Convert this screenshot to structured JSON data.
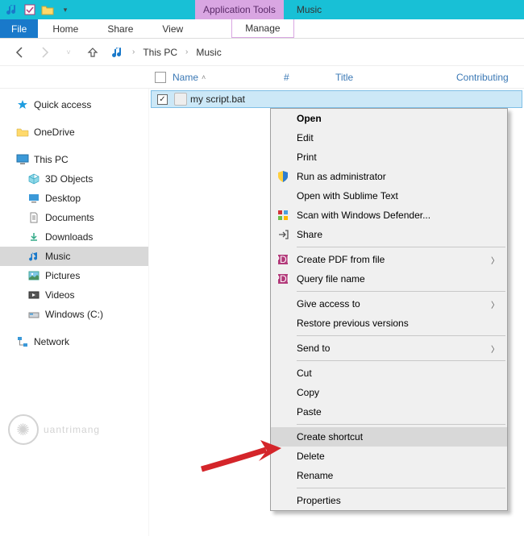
{
  "titlebar": {
    "app_tools_label": "Application Tools",
    "window_title": "Music"
  },
  "ribbon": {
    "file": "File",
    "tabs": [
      "Home",
      "Share",
      "View"
    ],
    "manage": "Manage"
  },
  "breadcrumb": {
    "items": [
      "This PC",
      "Music"
    ]
  },
  "columns": {
    "name": "Name",
    "num": "#",
    "title": "Title",
    "contrib": "Contributing"
  },
  "sidebar": {
    "quick_access": "Quick access",
    "onedrive": "OneDrive",
    "this_pc": "This PC",
    "children": [
      "3D Objects",
      "Desktop",
      "Documents",
      "Downloads",
      "Music",
      "Pictures",
      "Videos",
      "Windows (C:)"
    ],
    "network": "Network"
  },
  "file": {
    "name": "my script.bat"
  },
  "ctx": {
    "open": "Open",
    "edit": "Edit",
    "print": "Print",
    "run_admin": "Run as administrator",
    "open_sublime": "Open with Sublime Text",
    "scan_defender": "Scan with Windows Defender...",
    "share": "Share",
    "create_pdf": "Create PDF from file",
    "query_filename": "Query file name",
    "give_access": "Give access to",
    "restore_prev": "Restore previous versions",
    "send_to": "Send to",
    "cut": "Cut",
    "copy": "Copy",
    "paste": "Paste",
    "create_shortcut": "Create shortcut",
    "delete": "Delete",
    "rename": "Rename",
    "properties": "Properties"
  },
  "watermark": "uantrimang"
}
